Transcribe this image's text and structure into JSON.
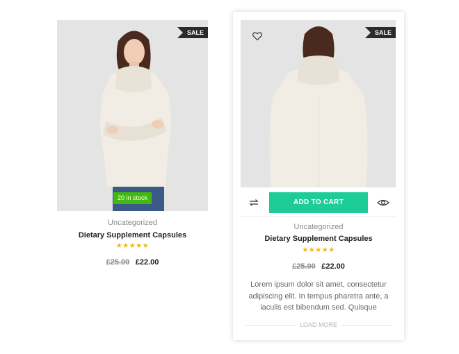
{
  "products": [
    {
      "sale_label": "SALE",
      "stock_badge": "20 in stock",
      "category": "Uncategorized",
      "title": "Dietary Supplement Capsules",
      "rating_stars": "★★★★★",
      "rating": 5,
      "old_price": "£25.00",
      "new_price": "£22.00"
    },
    {
      "sale_label": "SALE",
      "add_to_cart_label": "ADD TO CART",
      "category": "Uncategorized",
      "title": "Dietary Supplement Capsules",
      "rating_stars": "★★★★★",
      "rating": 5,
      "old_price": "£25.00",
      "new_price": "£22.00",
      "description": "Lorem ipsum dolor sit amet, consectetur adipiscing elit. In tempus pharetra ante, a iaculis est bibendum sed. Quisque",
      "load_more_label": "LOAD MORE"
    }
  ],
  "icons": {
    "wishlist": "heart-icon",
    "compare": "compare-arrows-icon",
    "quick_view": "eye-icon"
  },
  "colors": {
    "sale_tag": "#2b2b2b",
    "stock_badge": "#43b90f",
    "add_to_cart": "#1ecc9a",
    "stars": "#f6b800"
  }
}
